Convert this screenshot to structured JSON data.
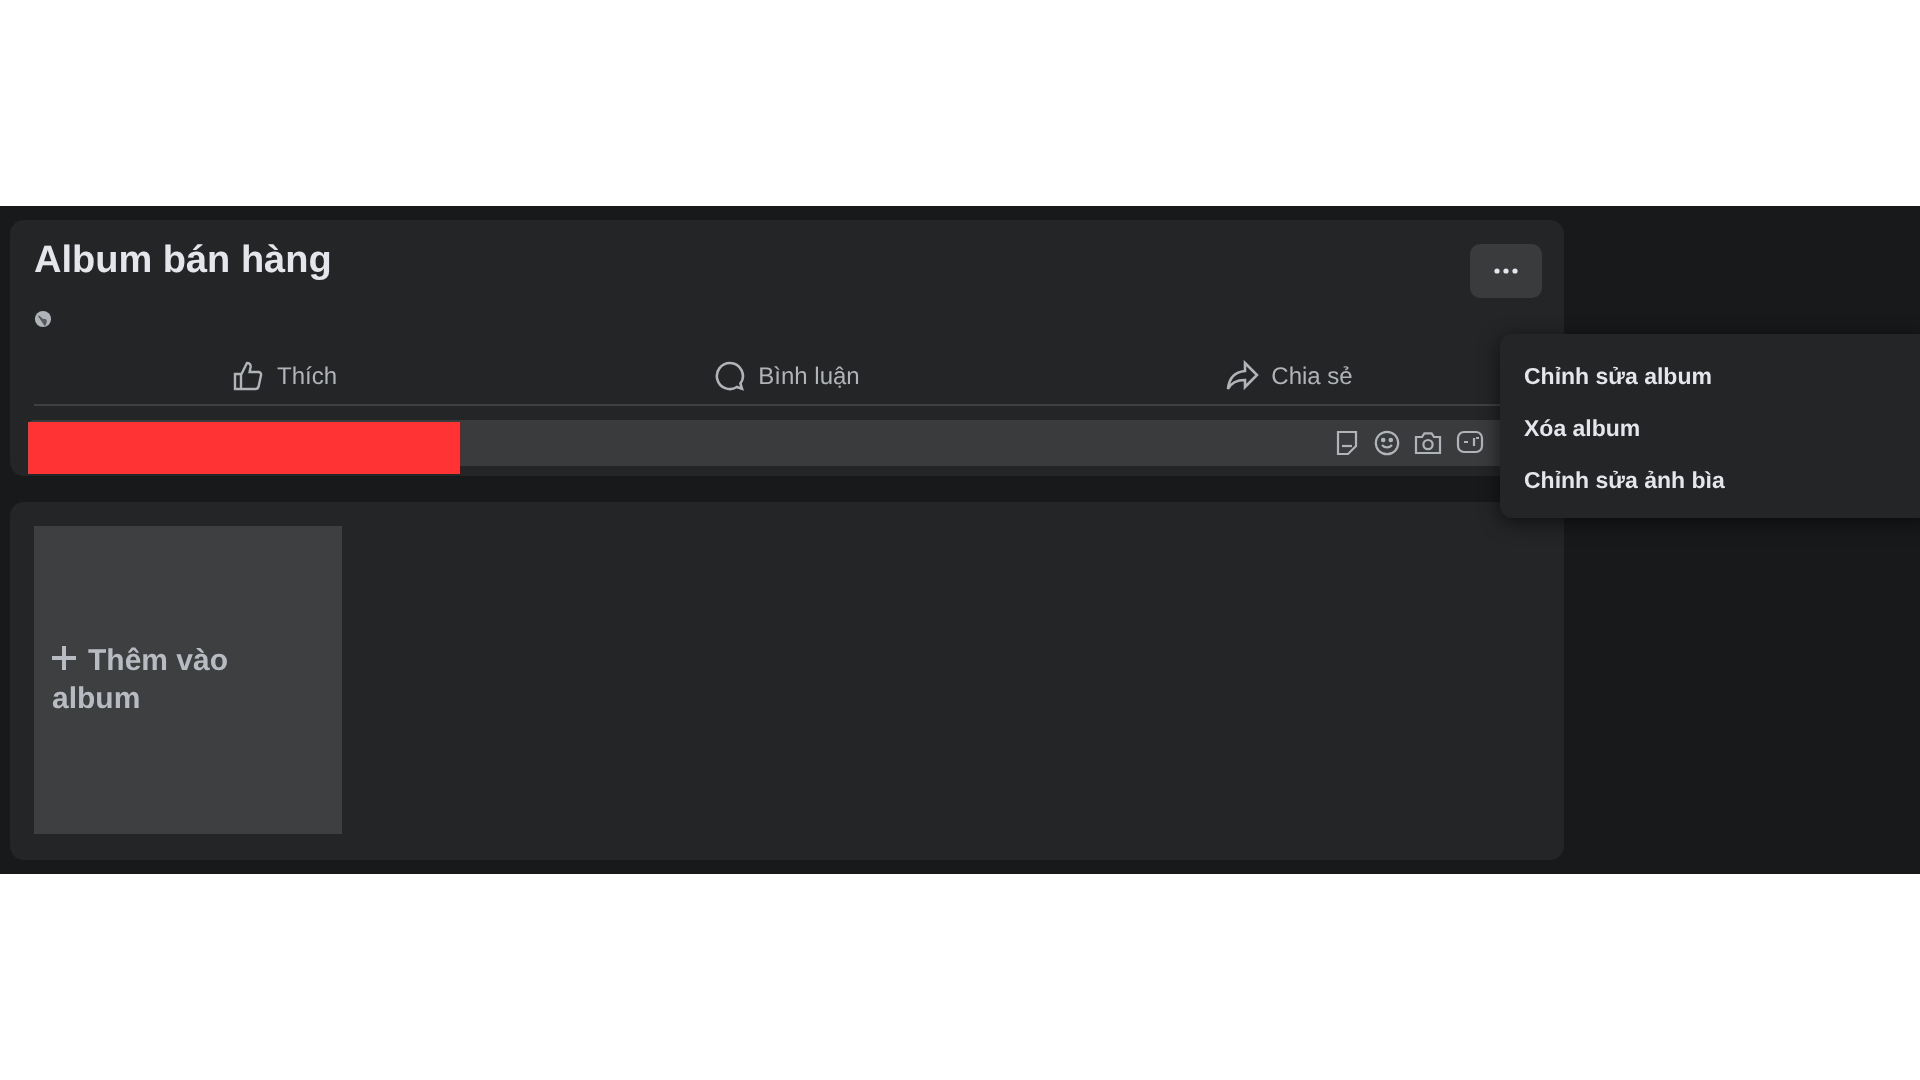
{
  "album": {
    "title": "Album bán hàng"
  },
  "actions": [
    {
      "kind": "like",
      "label": "Thích"
    },
    {
      "kind": "comment",
      "label": "Bình luận"
    },
    {
      "kind": "share",
      "label": "Chia sẻ"
    }
  ],
  "comment_field": {
    "redacted": true
  },
  "menu": {
    "open": true,
    "items": [
      "Chỉnh sửa album",
      "Xóa album",
      "Chỉnh sửa ảnh bìa"
    ]
  },
  "add_tile": {
    "label": "Thêm vào album"
  }
}
